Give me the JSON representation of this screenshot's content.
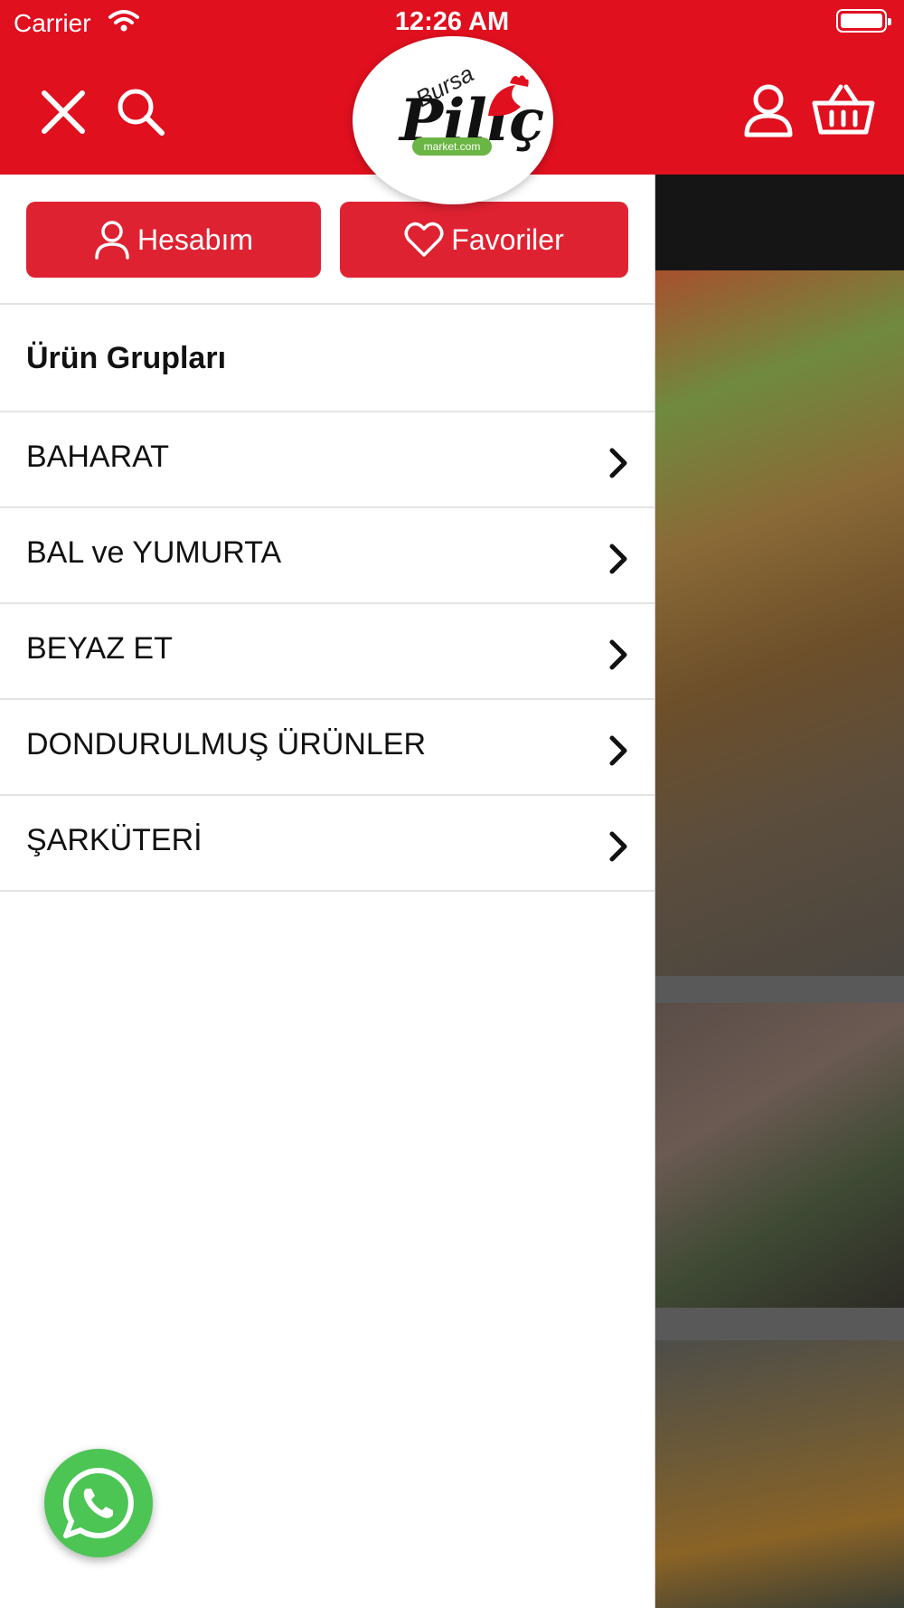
{
  "status_bar": {
    "carrier": "Carrier",
    "time": "12:26 AM"
  },
  "header": {
    "logo": {
      "line1": "Bursa",
      "line2": "Piliç",
      "badge": "market.com"
    },
    "icons": [
      "close-icon",
      "search-icon",
      "user-icon",
      "basket-icon"
    ]
  },
  "drawer": {
    "account_button": "Hesabım",
    "favorites_button": "Favoriler",
    "section_title": "Ürün Grupları",
    "categories": [
      {
        "label": "BAHARAT"
      },
      {
        "label": "BAL ve YUMURTA"
      },
      {
        "label": "BEYAZ ET"
      },
      {
        "label": "DONDURULMUŞ ÜRÜNLER"
      },
      {
        "label": "ŞARKÜTERİ"
      }
    ]
  },
  "floating": {
    "icon": "whatsapp-icon"
  },
  "colors": {
    "brand_red": "#e1101f",
    "button_red": "#df2231",
    "whatsapp_green": "#4cc555"
  }
}
